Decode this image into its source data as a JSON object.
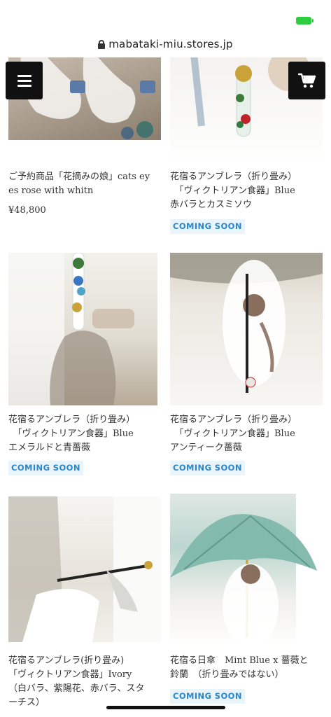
{
  "browser": {
    "url": "mabataki-miu.stores.jp",
    "lock_icon": "lock-icon",
    "battery_color": "#2ecc40"
  },
  "header": {
    "menu_icon": "hamburger-menu-icon",
    "cart_icon": "shopping-cart-icon"
  },
  "colors": {
    "badge_text": "#2b87c8",
    "badge_bg": "#eaf4fb",
    "button_bg": "#111111"
  },
  "products": [
    {
      "title": "ご予約商品「花摘みの娘」cats ey\nes rose with whitn",
      "price": "¥48,800"
    },
    {
      "title": "花宿るアンブレラ（折り畳み）\n　「ヴィクトリアン食器」Blue\n赤バラとカスミソウ",
      "badge": "COMING SOON"
    },
    {
      "title": "花宿るアンブレラ（折り畳み）\n　「ヴィクトリアン食器」Blue\nエメラルドと青薔薇",
      "badge": "COMING SOON"
    },
    {
      "title": "花宿るアンブレラ（折り畳み）\n　「ヴィクトリアン食器」Blue\nアンティーク薔薇",
      "badge": "COMING SOON"
    },
    {
      "title": "花宿るアンブレラ(折り畳み)\n「ヴィクトリアン食器」Ivory\n（白バラ、紫陽花、赤バラ、スタ\nーチス）"
    },
    {
      "title": "花宿る日傘　Mint Blue x 薔薇と\n鈴蘭　（折り畳みではない）",
      "badge": "COMING SOON"
    }
  ]
}
